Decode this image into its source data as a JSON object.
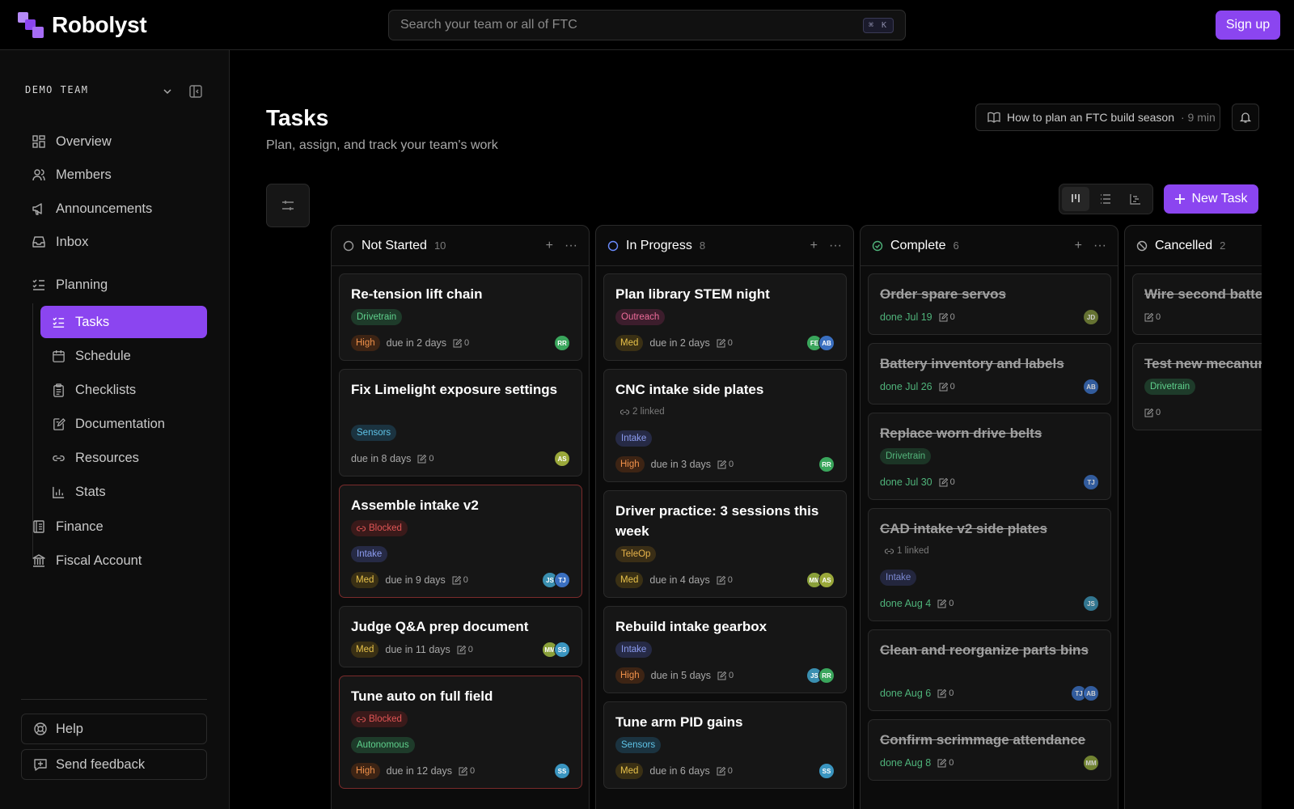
{
  "app": {
    "name": "Robolyst"
  },
  "search": {
    "placeholder": "Search your team or all of FTC",
    "shortcut": "⌘ K"
  },
  "header": {
    "signup": "Sign up"
  },
  "sidebar": {
    "team": "DEMO TEAM",
    "items": [
      {
        "label": "Overview",
        "icon": "grid-icon"
      },
      {
        "label": "Members",
        "icon": "users-icon"
      },
      {
        "label": "Announcements",
        "icon": "megaphone-icon"
      },
      {
        "label": "Inbox",
        "icon": "inbox-icon"
      },
      {
        "label": "Planning",
        "icon": "list-check-icon"
      }
    ],
    "planning": [
      {
        "label": "Tasks",
        "icon": "tasks-icon"
      },
      {
        "label": "Schedule",
        "icon": "calendar-icon"
      },
      {
        "label": "Checklists",
        "icon": "clipboard-icon"
      },
      {
        "label": "Documentation",
        "icon": "edit-doc-icon"
      },
      {
        "label": "Resources",
        "icon": "link-icon"
      },
      {
        "label": "Stats",
        "icon": "bar-chart-icon"
      }
    ],
    "bottom_items": [
      {
        "label": "Finance",
        "icon": "ledger-icon"
      },
      {
        "label": "Fiscal Account",
        "icon": "bank-icon"
      }
    ],
    "help": "Help",
    "feedback": "Send feedback"
  },
  "page": {
    "title": "Tasks",
    "subtitle": "Plan, assign, and track your team's work",
    "guide": "How to plan an FTC build season",
    "guide_time": "· 9 min",
    "new_task": "New Task"
  },
  "colors": {
    "accent": "#8b45f0",
    "done": "#4fb37a",
    "blocked": "#e05555"
  },
  "columns": [
    {
      "title": "Not Started",
      "count": "10",
      "status": "not-started",
      "cards": [
        {
          "title": "Re-tension lift chain",
          "tags": [
            {
              "text": "Drivetrain",
              "kind": "drivetrain"
            }
          ],
          "priority": "High",
          "due": "due in 2 days",
          "comments": "0",
          "avatars": [
            "RR"
          ]
        },
        {
          "title": "Fix Limelight exposure settings",
          "tags": [
            {
              "text": "Sensors",
              "kind": "sensors"
            }
          ],
          "priority": "",
          "due": "due in 8 days",
          "comments": "0",
          "avatars": [
            "AS"
          ]
        },
        {
          "title": "Assemble intake v2",
          "blocked": "Blocked",
          "tags": [
            {
              "text": "Intake",
              "kind": "intake"
            }
          ],
          "priority": "Med",
          "due": "due in 9 days",
          "comments": "0",
          "avatars": [
            "JS",
            "TJ"
          ]
        },
        {
          "title": "Judge Q&A prep document",
          "tags": [],
          "priority": "Med",
          "due": "due in 11 days",
          "comments": "0",
          "avatars": [
            "MM",
            "SS"
          ]
        },
        {
          "title": "Tune auto on full field",
          "blocked": "Blocked",
          "tags": [
            {
              "text": "Autonomous",
              "kind": "autonomous"
            }
          ],
          "priority": "High",
          "due": "due in 12 days",
          "comments": "0",
          "avatars": [
            "SS"
          ]
        }
      ]
    },
    {
      "title": "In Progress",
      "count": "8",
      "status": "in-progress",
      "cards": [
        {
          "title": "Plan library STEM night",
          "tags": [
            {
              "text": "Outreach",
              "kind": "outreach"
            }
          ],
          "priority": "Med",
          "due": "due in 2 days",
          "comments": "0",
          "avatars": [
            "FE",
            "AB"
          ]
        },
        {
          "title": "CNC intake side plates",
          "linked": "2 linked",
          "tags": [
            {
              "text": "Intake",
              "kind": "intake"
            }
          ],
          "priority": "High",
          "due": "due in 3 days",
          "comments": "0",
          "avatars": [
            "RR"
          ]
        },
        {
          "title": "Driver practice: 3 sessions this week",
          "tags": [
            {
              "text": "TeleOp",
              "kind": "teleop"
            }
          ],
          "priority": "Med",
          "due": "due in 4 days",
          "comments": "0",
          "avatars": [
            "MM",
            "AS"
          ]
        },
        {
          "title": "Rebuild intake gearbox",
          "tags": [
            {
              "text": "Intake",
              "kind": "intake"
            }
          ],
          "priority": "High",
          "due": "due in 5 days",
          "comments": "0",
          "avatars": [
            "JS",
            "RR"
          ]
        },
        {
          "title": "Tune arm PID gains",
          "tags": [
            {
              "text": "Sensors",
              "kind": "sensors"
            }
          ],
          "priority": "Med",
          "due": "due in 6 days",
          "comments": "0",
          "avatars": [
            "SS"
          ]
        }
      ]
    },
    {
      "title": "Complete",
      "count": "6",
      "status": "complete",
      "cards": [
        {
          "title": "Order spare servos",
          "tags": [],
          "done": "done Jul 19",
          "comments": "0",
          "avatars": [
            "JD"
          ]
        },
        {
          "title": "Battery inventory and labels",
          "tags": [],
          "done": "done Jul 26",
          "comments": "0",
          "avatars": [
            "AB"
          ]
        },
        {
          "title": "Replace worn drive belts",
          "tags": [
            {
              "text": "Drivetrain",
              "kind": "drivetrain"
            }
          ],
          "done": "done Jul 30",
          "comments": "0",
          "avatars": [
            "TJ"
          ]
        },
        {
          "title": "CAD intake v2 side plates",
          "linked": "1 linked",
          "tags": [
            {
              "text": "Intake",
              "kind": "intake"
            }
          ],
          "done": "done Aug 4",
          "comments": "0",
          "avatars": [
            "JS"
          ]
        },
        {
          "title": "Clean and reorganize parts bins",
          "tags": [],
          "done": "done Aug 6",
          "comments": "0",
          "avatars": [
            "TJ",
            "AB"
          ]
        },
        {
          "title": "Confirm scrimmage attendance",
          "tags": [],
          "done": "done Aug 8",
          "comments": "0",
          "avatars": [
            "MM"
          ]
        }
      ]
    },
    {
      "title": "Cancelled",
      "count": "2",
      "status": "cancelled",
      "cards": [
        {
          "title": "Wire second battery gauge",
          "tags": [],
          "comments": "0",
          "avatars": []
        },
        {
          "title": "Test new mecanum wheels",
          "tags": [
            {
              "text": "Drivetrain",
              "kind": "drivetrain"
            }
          ],
          "comments": "0",
          "avatars": []
        }
      ]
    }
  ]
}
